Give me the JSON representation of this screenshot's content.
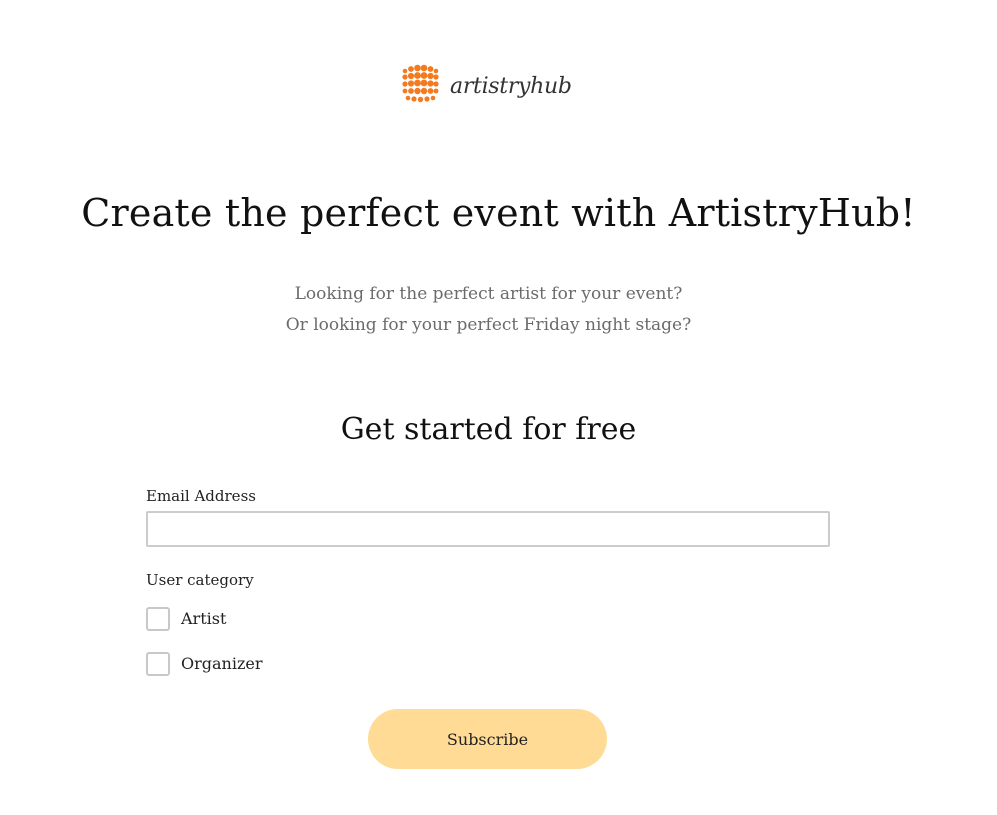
{
  "brand": {
    "logo_text": "artistryhub",
    "logo_color": "#f47a1f"
  },
  "hero": {
    "headline": "Create the perfect event with ArtistryHub!",
    "subtitle_line1": "Looking for the perfect artist for your event?",
    "subtitle_line2": "Or looking for your perfect Friday night stage?"
  },
  "form": {
    "title": "Get started for free",
    "email": {
      "label": "Email Address",
      "value": "",
      "placeholder": ""
    },
    "category": {
      "label": "User category",
      "options": [
        {
          "label": "Artist",
          "checked": false
        },
        {
          "label": "Organizer",
          "checked": false
        }
      ]
    },
    "submit_label": "Subscribe"
  },
  "colors": {
    "accent": "#ffdb96",
    "brand": "#f47a1f",
    "muted_text": "#6b6b6b",
    "input_border": "#cccccc"
  }
}
